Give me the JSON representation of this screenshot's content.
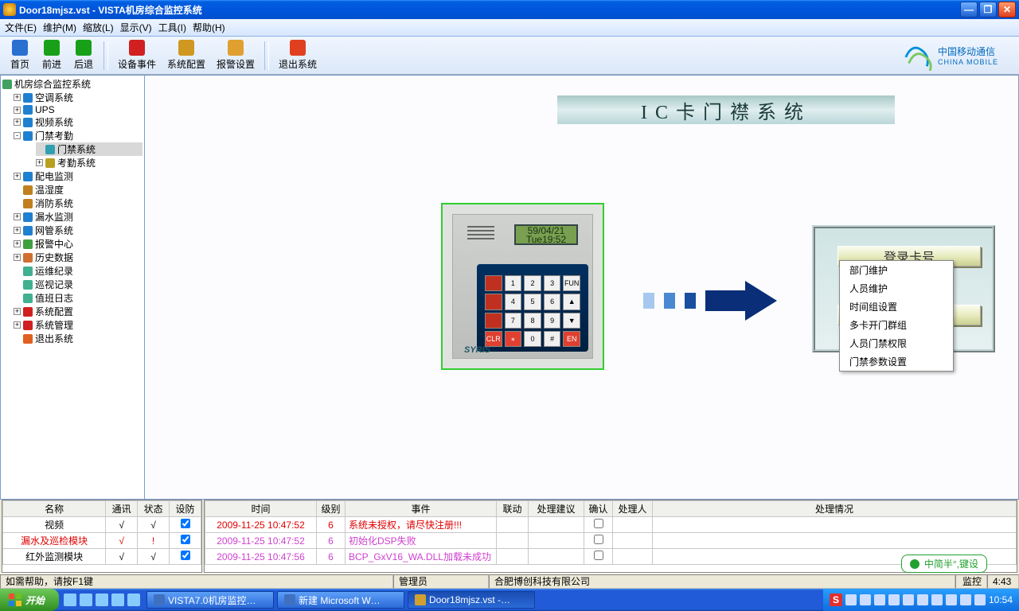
{
  "window": {
    "title": "Door18mjsz.vst - VISTA机房综合监控系统"
  },
  "menu": [
    "文件(E)",
    "维护(M)",
    "缩放(L)",
    "显示(V)",
    "工具(I)",
    "帮助(H)"
  ],
  "toolbar": [
    {
      "label": "首页",
      "color": "#2a70d0"
    },
    {
      "label": "前进",
      "color": "#18a018"
    },
    {
      "label": "后退",
      "color": "#18a018"
    },
    {
      "sep": true
    },
    {
      "label": "设备事件",
      "color": "#d02020"
    },
    {
      "label": "系统配置",
      "color": "#d09820"
    },
    {
      "label": "报警设置",
      "color": "#e0a030"
    },
    {
      "sep": true
    },
    {
      "label": "退出系统",
      "color": "#e04020"
    }
  ],
  "brand": {
    "cn": "中国移动通信",
    "en": "CHINA MOBILE"
  },
  "tree": {
    "root": "机房综合监控系统",
    "items": [
      {
        "exp": "+",
        "ic": "#2080d0",
        "label": "空调系统"
      },
      {
        "exp": "+",
        "ic": "#2080d0",
        "label": "UPS"
      },
      {
        "exp": "+",
        "ic": "#2080d0",
        "label": "视频系统"
      },
      {
        "exp": "-",
        "ic": "#2080d0",
        "label": "门禁考勤",
        "children": [
          {
            "exp": "",
            "ic": "#30a0b0",
            "label": "门禁系统",
            "sel": true
          },
          {
            "exp": "+",
            "ic": "#b8a020",
            "label": "考勤系统"
          }
        ]
      },
      {
        "exp": "+",
        "ic": "#2080d0",
        "label": "配电监测"
      },
      {
        "exp": "",
        "ic": "#c08020",
        "label": "温湿度"
      },
      {
        "exp": "",
        "ic": "#c08020",
        "label": "消防系统"
      },
      {
        "exp": "+",
        "ic": "#2080d0",
        "label": "漏水监测"
      },
      {
        "exp": "+",
        "ic": "#2080d0",
        "label": "网管系统"
      },
      {
        "exp": "+",
        "ic": "#40a040",
        "label": "报警中心"
      },
      {
        "exp": "+",
        "ic": "#d07030",
        "label": "历史数据"
      },
      {
        "exp": "",
        "ic": "#40b090",
        "label": "运维纪录"
      },
      {
        "exp": "",
        "ic": "#40b090",
        "label": "巡视记录"
      },
      {
        "exp": "",
        "ic": "#40b090",
        "label": "值班日志"
      },
      {
        "exp": "+",
        "ic": "#d02020",
        "label": "系统配置"
      },
      {
        "exp": "+",
        "ic": "#d02020",
        "label": "系统管理"
      },
      {
        "exp": "",
        "ic": "#e06020",
        "label": "退出系统"
      }
    ]
  },
  "page": {
    "title": "IC卡门襟系统",
    "display_l1": "59/04/21",
    "display_l2": "Tue19:52",
    "keypad_brand": "SYRIS",
    "btn1": "登录卡号",
    "btn2": "录",
    "keys": [
      "",
      "1",
      "2",
      "3",
      "FUN",
      "",
      "4",
      "5",
      "6",
      "▲",
      "",
      "7",
      "8",
      "9",
      "▼",
      "CLR",
      "⁎",
      "0",
      "#",
      "EN"
    ]
  },
  "ctxmenu": [
    "部门维护",
    "人员维护",
    "时间组设置",
    "多卡开门群组",
    "人员门禁权限",
    "门禁参数设置"
  ],
  "grid1": {
    "headers": [
      "名称",
      "通讯",
      "状态",
      "设防"
    ],
    "rows": [
      {
        "c": [
          "视频",
          "√",
          "√",
          "☑"
        ],
        "color": "#000"
      },
      {
        "c": [
          "漏水及巡检模块",
          "√",
          "!",
          "☑"
        ],
        "color": "#e00000"
      },
      {
        "c": [
          "红外监测模块",
          "√",
          "√",
          "☑"
        ],
        "color": "#000"
      }
    ]
  },
  "grid2": {
    "headers": [
      "时间",
      "级别",
      "事件",
      "联动",
      "处理建议",
      "确认",
      "处理人",
      "处理情况"
    ],
    "rows": [
      {
        "c": [
          "2009-11-25 10:47:52",
          "6",
          "系统未授权，请尽快注册!!!",
          "",
          "",
          "",
          "",
          ""
        ],
        "color": "#e00000"
      },
      {
        "c": [
          "2009-11-25 10:47:52",
          "6",
          "初始化DSP失败",
          "",
          "",
          "",
          "",
          ""
        ],
        "color": "#d040d0"
      },
      {
        "c": [
          "2009-11-25 10:47:56",
          "6",
          "BCP_GxV16_WA.DLL加载未成功",
          "",
          "",
          "",
          "",
          ""
        ],
        "color": "#d040d0"
      }
    ]
  },
  "status": {
    "help": "如需帮助，请按F1键",
    "admin": "管理员",
    "company": "合肥博创科技有限公司",
    "mon": "监控",
    "tail": "4:43"
  },
  "ime": "中简半°,键设",
  "taskbar": {
    "start": "开始",
    "items": [
      {
        "label": "VISTA7.0机房监控…",
        "ic": "#4070c0"
      },
      {
        "label": "新建 Microsoft W…",
        "ic": "#4070c0"
      },
      {
        "label": "Door18mjsz.vst -…",
        "ic": "#d0a030",
        "active": true
      }
    ],
    "clock": "10:54"
  }
}
